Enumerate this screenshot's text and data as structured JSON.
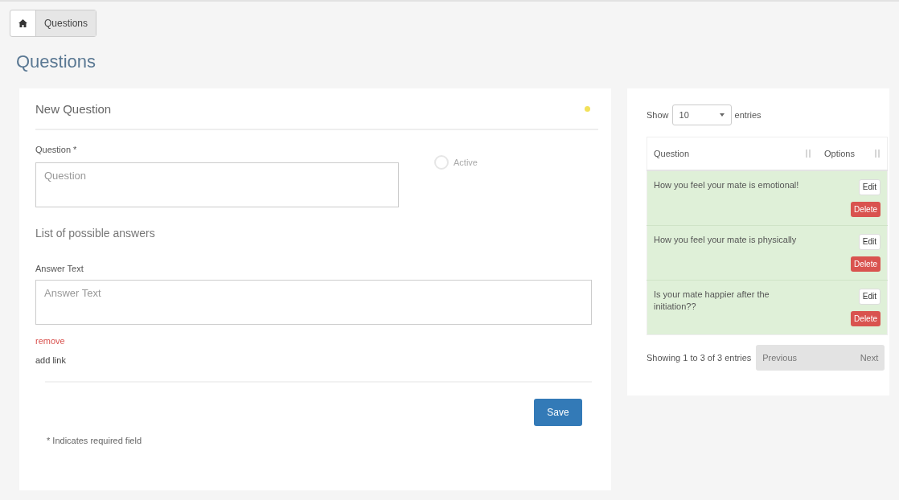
{
  "breadcrumb": [
    {
      "kind": "home"
    },
    {
      "kind": "text",
      "label": "Questions"
    }
  ],
  "page_title": "Questions",
  "form": {
    "title": "New Question",
    "question_label": "Question *",
    "question_placeholder": "Question",
    "active": {
      "label": "Active",
      "checked": false
    },
    "answers_heading": "List of possible answers",
    "answer_label": "Answer Text",
    "answer_placeholder": "Answer Text",
    "remove_link": "remove",
    "add_link": "add link",
    "save_button": "Save",
    "footnote": "* Indicates required field"
  },
  "table_panel": {
    "show_label": "Show",
    "page_size": "10",
    "entries_label": "entries",
    "columns": [
      "Question",
      "Options"
    ],
    "rows": [
      {
        "question": "How you feel your mate is emotional!",
        "edit": "Edit",
        "delete": "Delete"
      },
      {
        "question": "How you feel your mate is physically",
        "edit": "Edit",
        "delete": "Delete"
      },
      {
        "question": "Is your mate happier after the initiation??",
        "edit": "Edit",
        "delete": "Delete"
      }
    ],
    "info": "Showing 1 to 3 of 3 entries",
    "previous": "Previous",
    "next": "Next"
  }
}
